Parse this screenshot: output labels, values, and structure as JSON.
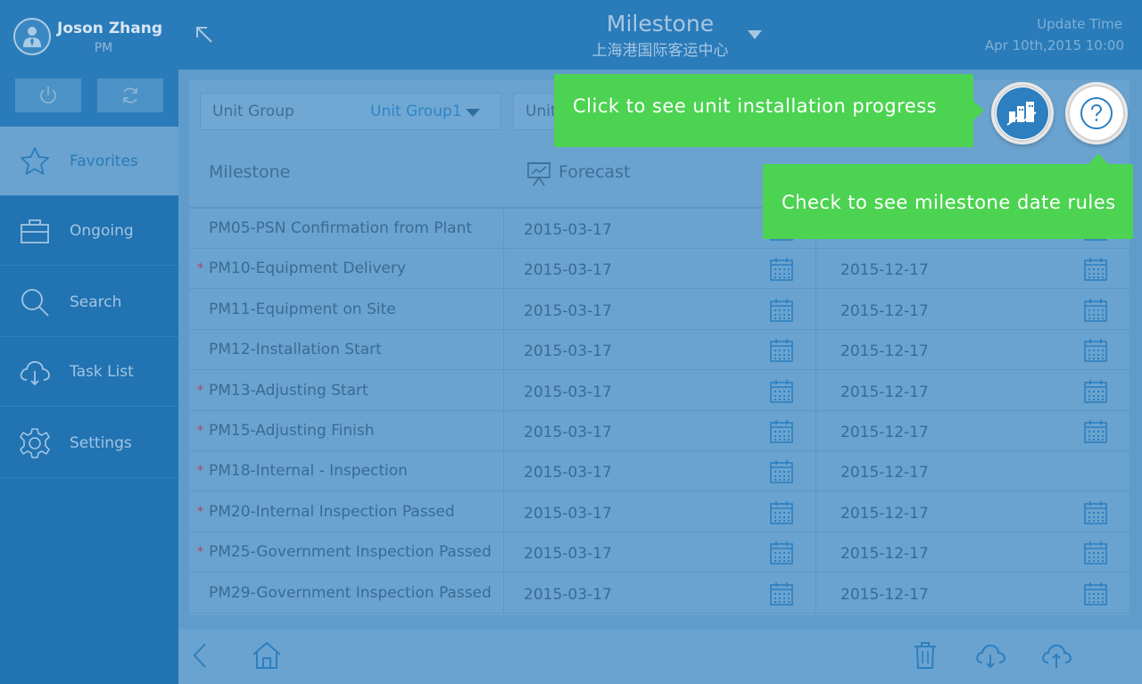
{
  "user": {
    "name": "Joson Zhang",
    "role": "PM"
  },
  "sidebar": {
    "items": [
      {
        "label": "Favorites",
        "icon": "star-icon",
        "active": true
      },
      {
        "label": "Ongoing",
        "icon": "briefcase-icon"
      },
      {
        "label": "Search",
        "icon": "search-icon"
      },
      {
        "label": "Task List",
        "icon": "cloud-download-icon"
      },
      {
        "label": "Settings",
        "icon": "gear-icon"
      }
    ]
  },
  "header": {
    "title": "Milestone",
    "subtitle": "上海港国际客运中心",
    "update_label": "Update Time",
    "update_value": "Apr 10th,2015 10:00"
  },
  "filters": {
    "unit_group_label": "Unit Group",
    "unit_group_value": "Unit Group1",
    "unit_label": "Unit"
  },
  "table": {
    "col_milestone": "Milestone",
    "col_forecast": "Forecast",
    "rows": [
      {
        "starred": false,
        "name": "PM05-PSN Confirmation from Plant",
        "forecast": "2015-03-17",
        "actual": ""
      },
      {
        "starred": true,
        "name": "PM10-Equipment Delivery",
        "forecast": "2015-03-17",
        "actual": "2015-12-17"
      },
      {
        "starred": false,
        "name": "PM11-Equipment on Site",
        "forecast": "2015-03-17",
        "actual": "2015-12-17"
      },
      {
        "starred": false,
        "name": "PM12-Installation Start",
        "forecast": "2015-03-17",
        "actual": "2015-12-17"
      },
      {
        "starred": true,
        "name": "PM13-Adjusting Start",
        "forecast": "2015-03-17",
        "actual": "2015-12-17"
      },
      {
        "starred": true,
        "name": "PM15-Adjusting Finish",
        "forecast": "2015-03-17",
        "actual": "2015-12-17"
      },
      {
        "starred": true,
        "name": "PM18-Internal - Inspection",
        "forecast": "2015-03-17",
        "actual": "2015-12-17"
      },
      {
        "starred": true,
        "name": "PM20-Internal Inspection Passed",
        "forecast": "2015-03-17",
        "actual": "2015-12-17"
      },
      {
        "starred": true,
        "name": "PM25-Government Inspection Passed",
        "forecast": "2015-03-17",
        "actual": "2015-12-17"
      },
      {
        "starred": false,
        "name": "PM29-Government Inspection Passed",
        "forecast": "2015-03-17",
        "actual": "2015-12-17"
      }
    ]
  },
  "tips": {
    "progress": "Click to see unit installation progress",
    "rules": "Check to see milestone date rules"
  },
  "colors": {
    "tip_green": "#4cd351",
    "brand_blue": "#2a7bb9"
  }
}
